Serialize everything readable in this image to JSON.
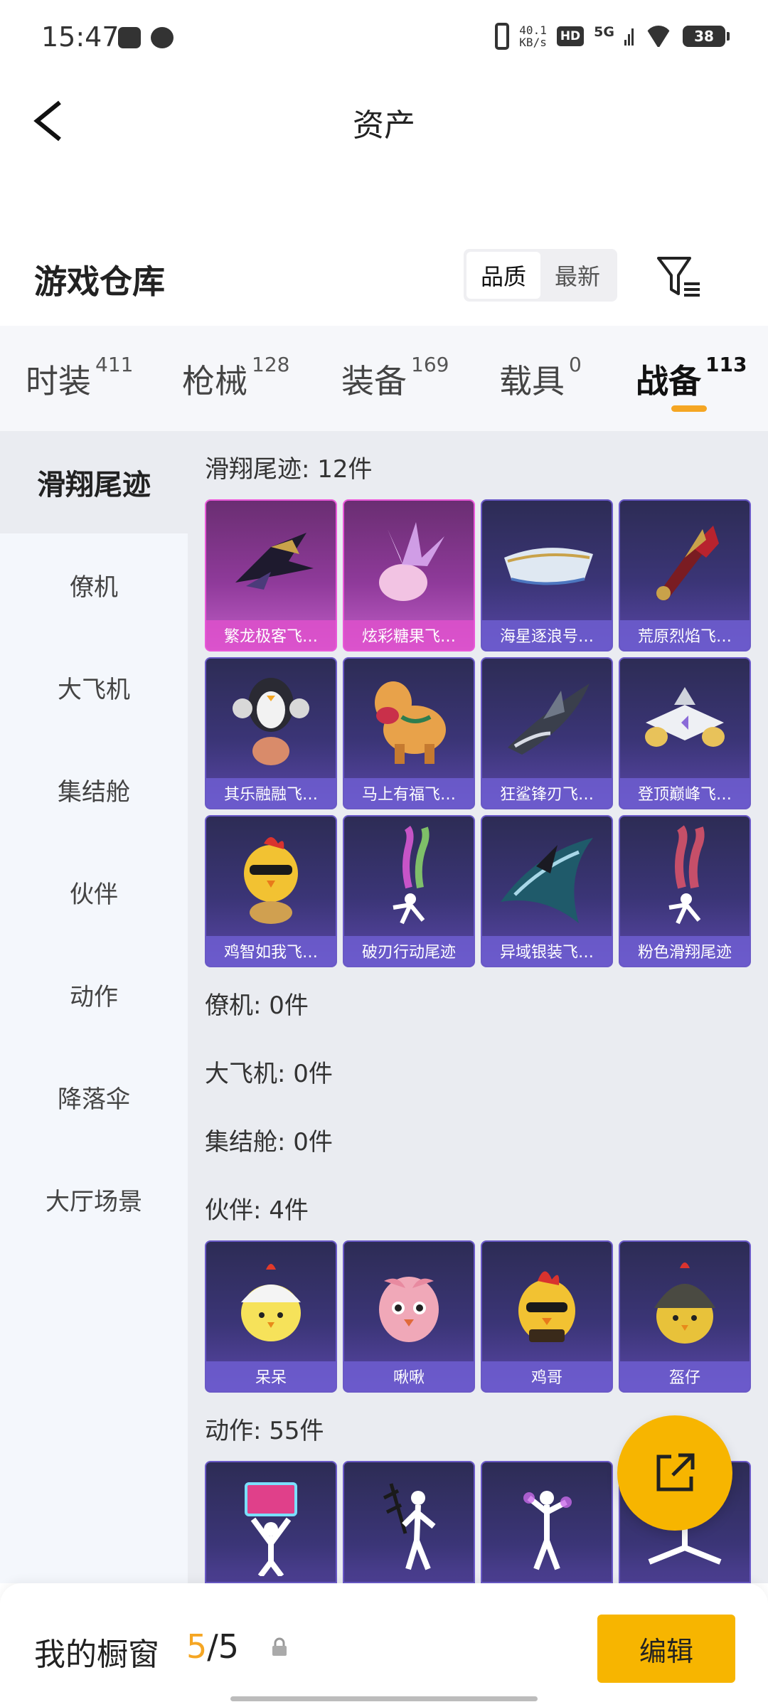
{
  "status_bar": {
    "time": "15:47",
    "net_speed_value": "40.1",
    "net_speed_unit": "KB/s",
    "hd": "HD",
    "network": "5G",
    "battery": "38"
  },
  "header": {
    "title": "资产",
    "back_icon": "chevron-left-icon"
  },
  "section": {
    "title": "游戏仓库",
    "sort_options": [
      "品质",
      "最新"
    ],
    "active_sort": "品质",
    "filter_icon": "filter-icon"
  },
  "tabs": [
    {
      "label": "时装",
      "count": "411"
    },
    {
      "label": "枪械",
      "count": "128"
    },
    {
      "label": "装备",
      "count": "169"
    },
    {
      "label": "载具",
      "count": "0"
    },
    {
      "label": "战备",
      "count": "113",
      "active": true
    }
  ],
  "sidebar": {
    "items": [
      "滑翔尾迹",
      "僚机",
      "大飞机",
      "集结舱",
      "伙伴",
      "动作",
      "降落伞",
      "大厅场景"
    ],
    "active": "滑翔尾迹"
  },
  "content": {
    "categories": [
      {
        "label": "滑翔尾迹: 12件",
        "items": [
          {
            "name": "繁龙极客飞…",
            "rarity": "legendary",
            "icon": "dragon-glider-icon"
          },
          {
            "name": "炫彩糖果飞…",
            "rarity": "legendary",
            "icon": "candy-glider-icon"
          },
          {
            "name": "海星逐浪号…",
            "rarity": "epic",
            "icon": "boat-glider-icon"
          },
          {
            "name": "荒原烈焰飞…",
            "rarity": "epic",
            "icon": "flame-glider-icon"
          },
          {
            "name": "其乐融融飞…",
            "rarity": "epic",
            "icon": "penguin-glider-icon"
          },
          {
            "name": "马上有福飞…",
            "rarity": "epic",
            "icon": "horse-glider-icon"
          },
          {
            "name": "狂鲨锋刃飞…",
            "rarity": "epic",
            "icon": "shark-glider-icon"
          },
          {
            "name": "登顶巅峰飞…",
            "rarity": "epic",
            "icon": "jet-glider-icon"
          },
          {
            "name": "鸡智如我飞…",
            "rarity": "epic",
            "icon": "chicken-glider-icon"
          },
          {
            "name": "破刃行动尾迹",
            "rarity": "epic",
            "icon": "smoke-trail-icon"
          },
          {
            "name": "异域银装飞…",
            "rarity": "epic",
            "icon": "silver-wing-icon"
          },
          {
            "name": "粉色滑翔尾迹",
            "rarity": "epic",
            "icon": "pink-smoke-trail-icon"
          }
        ]
      },
      {
        "label": "僚机: 0件",
        "items": []
      },
      {
        "label": "大飞机: 0件",
        "items": []
      },
      {
        "label": "集结舱: 0件",
        "items": []
      },
      {
        "label": "伙伴: 4件",
        "items": [
          {
            "name": "呆呆",
            "rarity": "epic",
            "icon": "chick-pet-icon"
          },
          {
            "name": "啾啾",
            "rarity": "epic",
            "icon": "pink-bird-pet-icon"
          },
          {
            "name": "鸡哥",
            "rarity": "epic",
            "icon": "rooster-pet-icon"
          },
          {
            "name": "盔仔",
            "rarity": "epic",
            "icon": "helmet-chick-pet-icon"
          }
        ]
      },
      {
        "label": "动作: 55件",
        "items": [
          {
            "name": "",
            "rarity": "epic",
            "icon": "emote-sign-icon"
          },
          {
            "name": "",
            "rarity": "epic",
            "icon": "emote-pose-icon"
          },
          {
            "name": "",
            "rarity": "epic",
            "icon": "emote-dance-icon"
          },
          {
            "name": "",
            "rarity": "epic",
            "icon": "emote-split-icon"
          }
        ]
      }
    ]
  },
  "fab": {
    "icon": "share-external-icon"
  },
  "bottom_bar": {
    "label": "我的橱窗",
    "count_current": "5",
    "count_total": "/5",
    "lock_icon": "lock-icon",
    "edit_label": "编辑"
  },
  "colors": {
    "accent": "#f7b500",
    "tab_indicator": "#f5a623",
    "card_epic": "#3b3577",
    "card_legendary": "#8f3a9a"
  }
}
